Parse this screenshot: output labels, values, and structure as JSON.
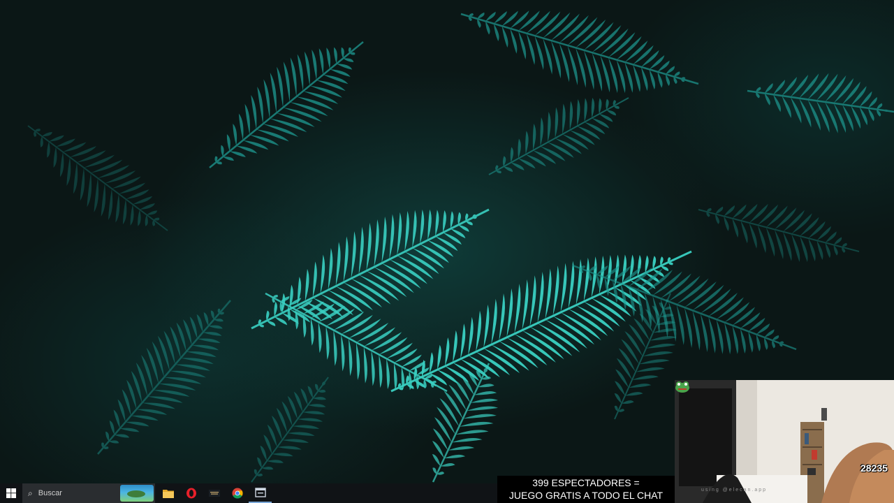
{
  "taskbar": {
    "search": {
      "placeholder": "Buscar"
    },
    "pinned": [
      {
        "name": "file-explorer",
        "icon": "folder-icon",
        "color": "#f2c14e"
      },
      {
        "name": "opera",
        "icon": "opera-icon",
        "color": "#e8202a"
      },
      {
        "name": "league",
        "icon": "league-icon",
        "color": "#c8aa6e"
      },
      {
        "name": "chrome",
        "icon": "chrome-icon",
        "color": "#4285f4"
      },
      {
        "name": "calculator",
        "icon": "window-app-icon",
        "color": "#7aa7d8"
      }
    ]
  },
  "stream_overlay": {
    "line1": "399 ESPECTADORES =",
    "line2": "JUEGO GRATIS A TODO EL CHAT"
  },
  "webcam": {
    "caption": "using @elecan.app",
    "badge": "28235"
  },
  "colors": {
    "fern": "#1e9a92",
    "fern_bright": "#3ad0c2",
    "taskbar": "#101316"
  }
}
